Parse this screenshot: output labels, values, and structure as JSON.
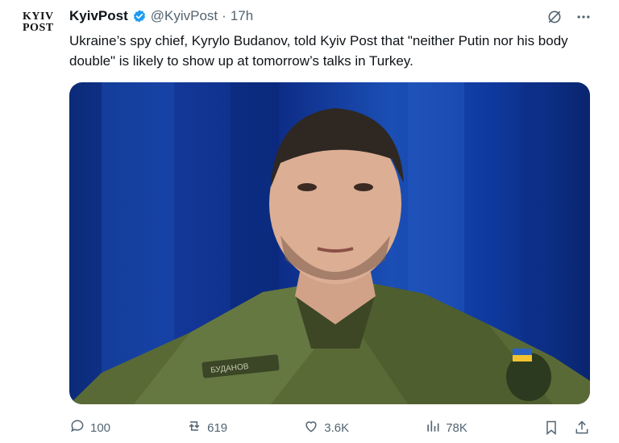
{
  "account": {
    "logo_line1": "KYIV",
    "logo_line2": "POST",
    "name": "KyivPost",
    "handle": "@KyivPost",
    "separator": "·",
    "time": "17h"
  },
  "tweet": {
    "text": "Ukraine’s spy chief, Kyrylo Budanov, told Kyiv Post that \"neither Putin nor his body double\" is likely to show up at tomorrow’s talks in Turkey."
  },
  "media": {
    "patch_text": "БУДАНОВ"
  },
  "stats": {
    "replies": "100",
    "reposts": "619",
    "likes": "3.6K",
    "views": "78K"
  },
  "icons": {
    "verified": "verified-badge-icon",
    "grok": "grok-icon",
    "more": "more-icon",
    "reply": "reply-icon",
    "repost": "repost-icon",
    "like": "like-icon",
    "views": "views-icon",
    "bookmark": "bookmark-icon",
    "share": "share-icon"
  },
  "colors": {
    "text": "#0f1419",
    "muted": "#536471",
    "verified": "#1d9bf0"
  }
}
